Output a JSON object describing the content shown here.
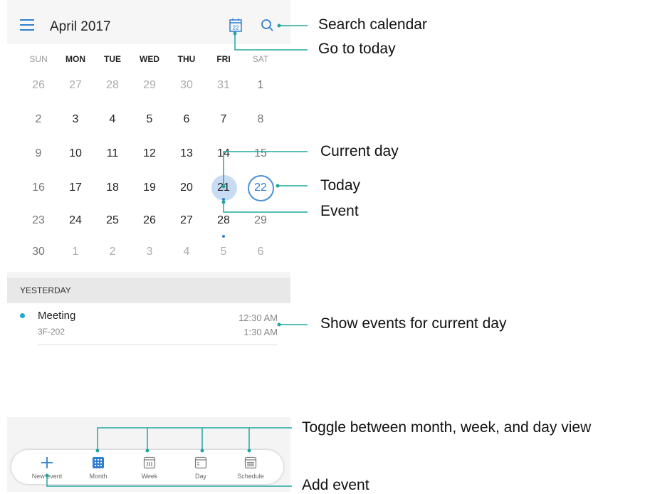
{
  "header": {
    "month_title": "April 2017"
  },
  "icons": {
    "menu": "menu-icon",
    "today": "calendar-today-icon",
    "search": "search-icon",
    "today_icon_number": "22"
  },
  "weekdays": [
    "SUN",
    "MON",
    "TUE",
    "WED",
    "THU",
    "FRI",
    "SAT"
  ],
  "weeks": [
    [
      "26",
      "27",
      "28",
      "29",
      "30",
      "31",
      "1"
    ],
    [
      "2",
      "3",
      "4",
      "5",
      "6",
      "7",
      "8"
    ],
    [
      "9",
      "10",
      "11",
      "12",
      "13",
      "14",
      "15"
    ],
    [
      "16",
      "17",
      "18",
      "19",
      "20",
      "21",
      "22"
    ],
    [
      "23",
      "24",
      "25",
      "26",
      "27",
      "28",
      "29"
    ],
    [
      "30",
      "1",
      "2",
      "3",
      "4",
      "5",
      "6"
    ]
  ],
  "selected_day": "21",
  "today_day": "22",
  "colors": {
    "accent": "#2f7fd2",
    "selected_fill": "#c7dcf2",
    "annotation_line": "#1fa7a0",
    "event_dot": "#22a8d8"
  },
  "events_section": {
    "heading": "YESTERDAY",
    "events": [
      {
        "title": "Meeting",
        "location": "3F-202",
        "start": "12:30 AM",
        "end": "1:30 AM"
      }
    ]
  },
  "toolbar": {
    "new_event": "New event",
    "month": "Month",
    "week": "Week",
    "day": "Day",
    "schedule": "Schedule"
  },
  "annotations": {
    "search": "Search calendar",
    "go_today": "Go to today",
    "current_day": "Current day",
    "today": "Today",
    "event": "Event",
    "show_events": "Show events for current day",
    "toggle_view": "Toggle between month, week, and day view",
    "add_event": "Add event"
  }
}
